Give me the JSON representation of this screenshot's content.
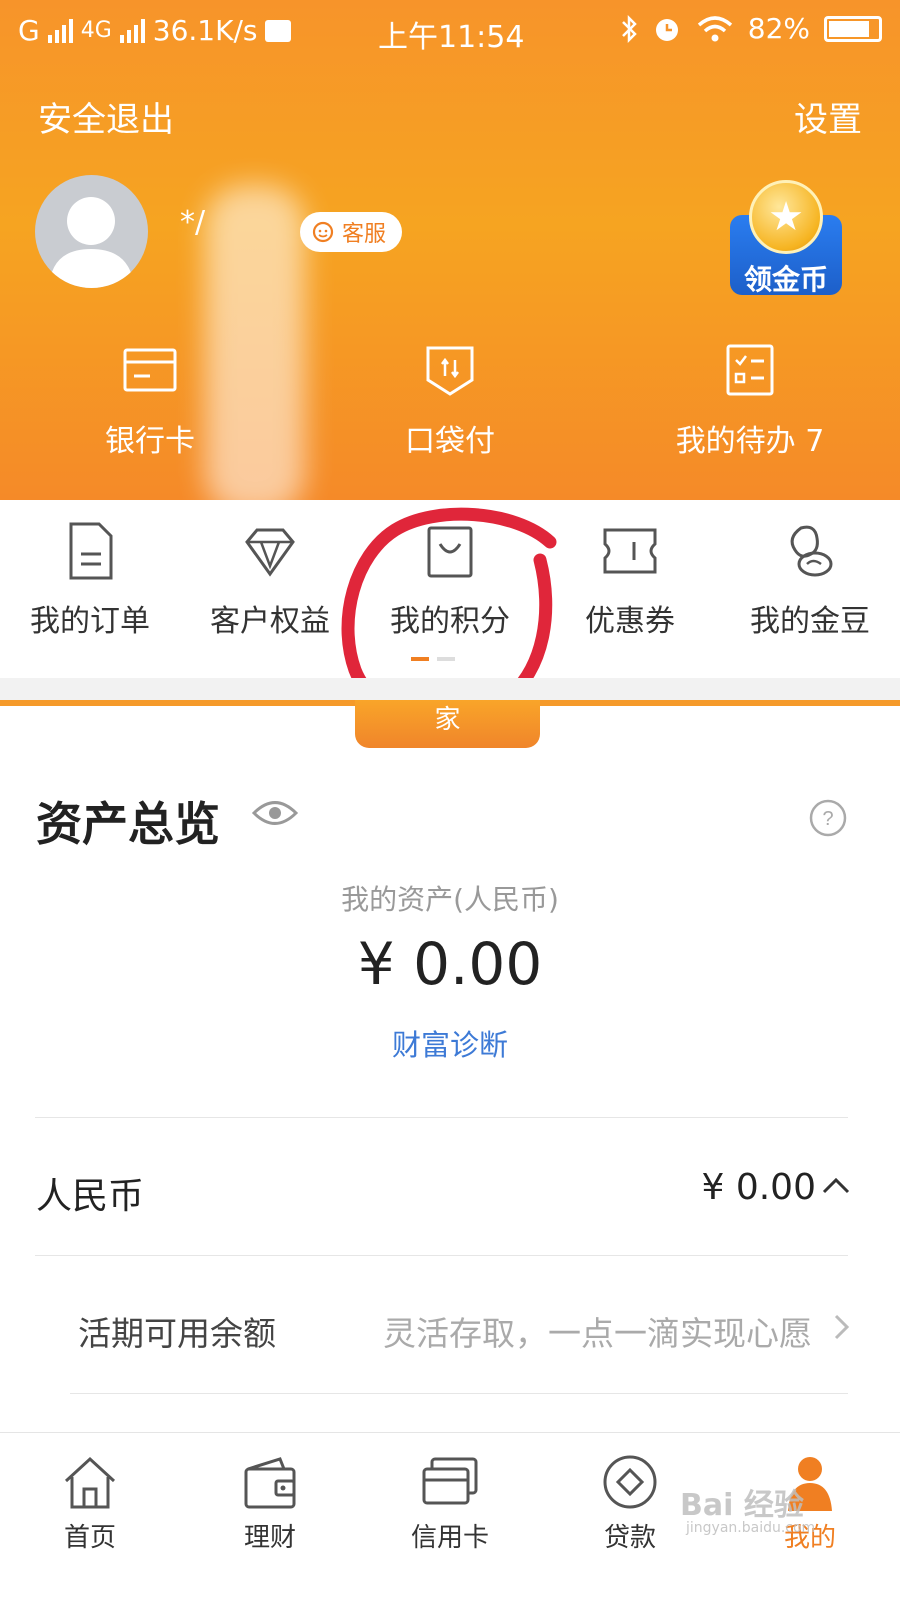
{
  "status_bar": {
    "carrier1": "G",
    "carrier2": "4G",
    "speed": "36.1K/s",
    "time": "上午11:54",
    "battery": "82%"
  },
  "header": {
    "logout": "安全退出",
    "settings": "设置",
    "username": "*/",
    "customer_service": "客服",
    "coin_label": "领金币",
    "quick_items": [
      {
        "label": "银行卡 ",
        "icon": "bank-card-icon"
      },
      {
        "label": "口袋付",
        "icon": "pocket-pay-icon"
      },
      {
        "label": "我的待办 7",
        "icon": "todo-list-icon"
      }
    ]
  },
  "shortcuts": [
    {
      "label": "我的订单",
      "icon": "order-icon"
    },
    {
      "label": "客户权益",
      "icon": "diamond-icon"
    },
    {
      "label": "我的积分",
      "icon": "shopping-bag-icon"
    },
    {
      "label": "优惠券",
      "icon": "coupon-icon"
    },
    {
      "label": "我的金豆",
      "icon": "golden-bean-icon"
    }
  ],
  "tab_bubble": "家",
  "assets": {
    "title": "资产总览",
    "subtitle": "我的资产(人民币)",
    "amount": "¥ 0.00",
    "wealth_link": "财富诊断",
    "rmb_label": "人民币",
    "rmb_value": "¥ 0.00",
    "current_label": "活期可用余额",
    "current_hint": "灵活存取，一点一滴实现心愿"
  },
  "bottom_nav": [
    {
      "label": "首页",
      "icon": "home-icon"
    },
    {
      "label": "理财",
      "icon": "wallet-icon"
    },
    {
      "label": "信用卡",
      "icon": "credit-card-icon"
    },
    {
      "label": "贷款",
      "icon": "loan-icon"
    },
    {
      "label": "我的",
      "icon": "profile-icon"
    }
  ],
  "watermark": {
    "main": "Bai 经验",
    "sub": "jingyan.baidu.com"
  },
  "colors": {
    "brand_orange": "#f7942a",
    "accent_orange": "#f07f22",
    "link_blue": "#3d7ad6",
    "annotation_red": "#e0263a"
  }
}
